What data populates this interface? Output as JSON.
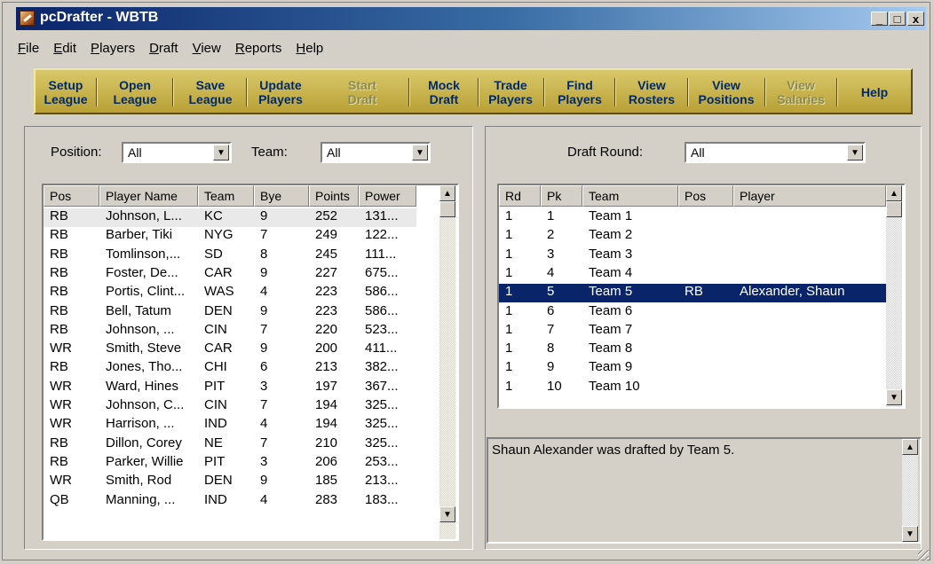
{
  "window": {
    "title": "pcDrafter - WBTB",
    "minimize": "_",
    "maximize": "□",
    "close": "x"
  },
  "menu": [
    "File",
    "Edit",
    "Players",
    "Draft",
    "View",
    "Reports",
    "Help"
  ],
  "toolbar": {
    "buttons": [
      {
        "label": "Setup\nLeague",
        "enabled": true
      },
      {
        "label": "Open\nLeague",
        "enabled": true
      },
      {
        "label": "Save\nLeague",
        "enabled": true
      },
      {
        "label": "Update\nPlayers",
        "enabled": true
      },
      {
        "label": "Start\nDraft",
        "enabled": false
      },
      {
        "label": "Mock\nDraft",
        "enabled": true
      },
      {
        "label": "Trade\nPlayers",
        "enabled": true
      },
      {
        "label": "Find\nPlayers",
        "enabled": true
      },
      {
        "label": "View\nRosters",
        "enabled": true
      },
      {
        "label": "View\nPositions",
        "enabled": true
      },
      {
        "label": "View\nSalaries",
        "enabled": false
      },
      {
        "label": "Help",
        "enabled": true
      }
    ]
  },
  "left": {
    "position_label": "Position:",
    "position_value": "All",
    "team_label": "Team:",
    "team_value": "All",
    "columns": [
      "Pos",
      "Player Name",
      "Team",
      "Bye",
      "Points",
      "Power"
    ],
    "rows": [
      [
        "RB",
        "Johnson, L...",
        "KC",
        "9",
        "252",
        "131..."
      ],
      [
        "RB",
        "Barber, Tiki",
        "NYG",
        "7",
        "249",
        "122..."
      ],
      [
        "RB",
        "Tomlinson,...",
        "SD",
        "8",
        "245",
        "111..."
      ],
      [
        "RB",
        "Foster, De...",
        "CAR",
        "9",
        "227",
        "675..."
      ],
      [
        "RB",
        "Portis, Clint...",
        "WAS",
        "4",
        "223",
        "586..."
      ],
      [
        "RB",
        "Bell, Tatum",
        "DEN",
        "9",
        "223",
        "586..."
      ],
      [
        "RB",
        "Johnson, ...",
        "CIN",
        "7",
        "220",
        "523..."
      ],
      [
        "WR",
        "Smith, Steve",
        "CAR",
        "9",
        "200",
        "411..."
      ],
      [
        "RB",
        "Jones, Tho...",
        "CHI",
        "6",
        "213",
        "382..."
      ],
      [
        "WR",
        "Ward, Hines",
        "PIT",
        "3",
        "197",
        "367..."
      ],
      [
        "WR",
        "Johnson, C...",
        "CIN",
        "7",
        "194",
        "325..."
      ],
      [
        "WR",
        "Harrison, ...",
        "IND",
        "4",
        "194",
        "325..."
      ],
      [
        "RB",
        "Dillon, Corey",
        "NE",
        "7",
        "210",
        "325..."
      ],
      [
        "RB",
        "Parker, Willie",
        "PIT",
        "3",
        "206",
        "253..."
      ],
      [
        "WR",
        "Smith, Rod",
        "DEN",
        "9",
        "185",
        "213..."
      ],
      [
        "QB",
        "Manning, ...",
        "IND",
        "4",
        "283",
        "183..."
      ]
    ]
  },
  "right": {
    "round_label": "Draft Round:",
    "round_value": "All",
    "columns": [
      "Rd",
      "Pk",
      "Team",
      "Pos",
      "Player"
    ],
    "rows": [
      [
        "1",
        "1",
        "Team 1",
        "",
        ""
      ],
      [
        "1",
        "2",
        "Team 2",
        "",
        ""
      ],
      [
        "1",
        "3",
        "Team 3",
        "",
        ""
      ],
      [
        "1",
        "4",
        "Team 4",
        "",
        ""
      ],
      [
        "1",
        "5",
        "Team 5",
        "RB",
        "Alexander, Shaun"
      ],
      [
        "1",
        "6",
        "Team 6",
        "",
        ""
      ],
      [
        "1",
        "7",
        "Team 7",
        "",
        ""
      ],
      [
        "1",
        "8",
        "Team 8",
        "",
        ""
      ],
      [
        "1",
        "9",
        "Team 9",
        "",
        ""
      ],
      [
        "1",
        "10",
        "Team 10",
        "",
        ""
      ]
    ],
    "selected_index": 4,
    "message": "Shaun Alexander was drafted by Team 5."
  },
  "colors": {
    "selection": "#0a246a",
    "toolbar_gold": "#c8b04a",
    "button_text": "#002a6a"
  }
}
